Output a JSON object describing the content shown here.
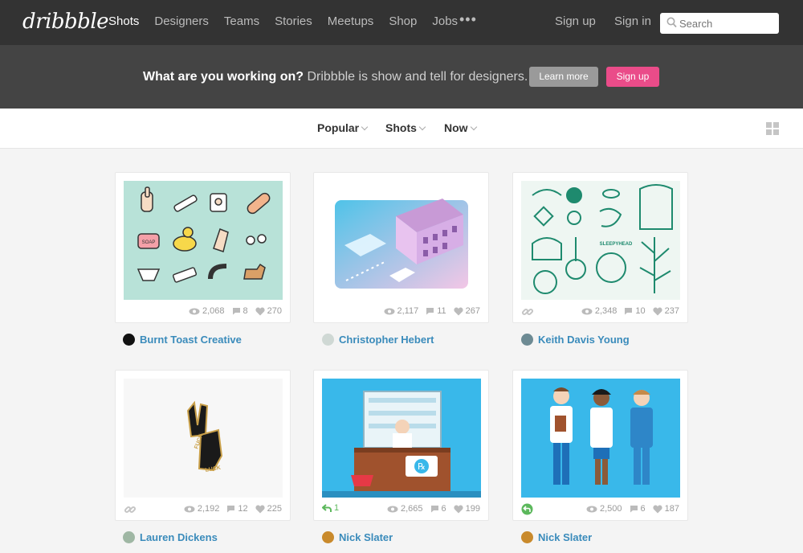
{
  "brand": {
    "logo_text": "dribbble"
  },
  "nav": {
    "items": [
      "Shots",
      "Designers",
      "Teams",
      "Stories",
      "Meetups",
      "Shop",
      "Jobs"
    ],
    "more": "•••",
    "sign_up": "Sign up",
    "sign_in": "Sign in",
    "search_placeholder": "Search"
  },
  "banner": {
    "headline": "What are you working on?",
    "tagline": " Dribbble is show and tell for designers.",
    "learn_more": "Learn more",
    "sign_up": "Sign up"
  },
  "filters": {
    "popular": "Popular",
    "shots": "Shots",
    "now": "Now"
  },
  "shots": [
    {
      "views": "2,068",
      "comments": "8",
      "likes": "270",
      "author": "Burnt Toast Creative",
      "icon_left": ""
    },
    {
      "views": "2,117",
      "comments": "11",
      "likes": "267",
      "author": "Christopher Hebert",
      "icon_left": ""
    },
    {
      "views": "2,348",
      "comments": "10",
      "likes": "237",
      "author": "Keith Davis Young",
      "icon_left": "link-icon"
    },
    {
      "views": "2,192",
      "comments": "12",
      "likes": "225",
      "author": "Lauren Dickens",
      "icon_left": "link-icon"
    },
    {
      "views": "2,665",
      "comments": "6",
      "likes": "199",
      "author": "Nick Slater",
      "icon_left": "rebound-icon",
      "rebounds": "1"
    },
    {
      "views": "2,500",
      "comments": "6",
      "likes": "187",
      "author": "Nick Slater",
      "icon_left": "rebound-circle-icon"
    }
  ],
  "thumb_texts": {
    "soap": "SOAP",
    "sleepyhead": "SLEEPYHEAD",
    "pin_top": "FUCK",
    "pin_bottom": "LUCK",
    "rx": "℞"
  },
  "colors": {
    "accent_pink": "#ea4c89",
    "link_blue": "#3a8bbb",
    "nav_bg": "#333333",
    "banner_bg": "#444444",
    "rebound_green": "#5cb85c"
  }
}
